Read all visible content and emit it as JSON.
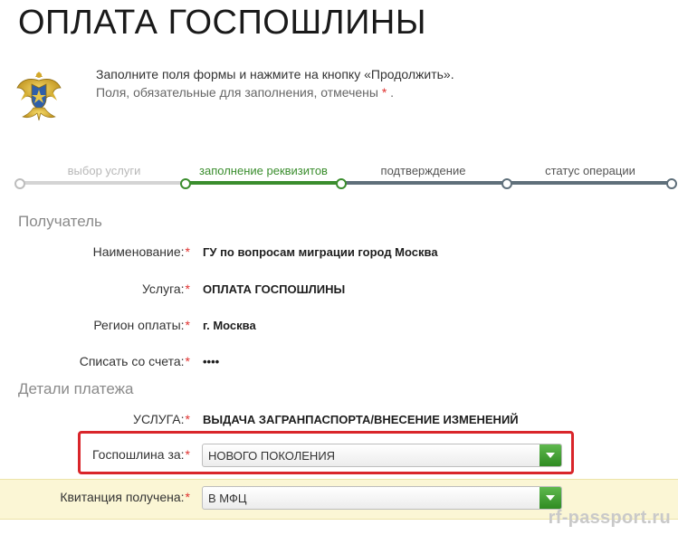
{
  "page": {
    "title": "ОПЛАТА ГОСПОШЛИНЫ",
    "instructions": {
      "line1": "Заполните поля формы и нажмите на кнопку «Продолжить».",
      "line2_text": "Поля, обязательные для заполнения, отмечены",
      "line2_mark": "*",
      "line2_end": "."
    }
  },
  "stepper": {
    "steps": [
      {
        "label": "выбор услуги",
        "state": "done"
      },
      {
        "label": "заполнение реквизитов",
        "state": "active"
      },
      {
        "label": "подтверждение",
        "state": "upcoming"
      },
      {
        "label": "статус операции",
        "state": "upcoming"
      }
    ],
    "colors": {
      "done": "#c8c8c8",
      "active": "#3a8d2d",
      "upcoming": "#5f6f7a"
    }
  },
  "recipient": {
    "title": "Получатель",
    "fields": [
      {
        "label": "Наименование:",
        "required": "*",
        "value": "ГУ по вопросам миграции город Москва"
      },
      {
        "label": "Услуга:",
        "required": "*",
        "value": "ОПЛАТА ГОСПОШЛИНЫ"
      },
      {
        "label": "Регион оплаты:",
        "required": "*",
        "value": "г. Москва"
      },
      {
        "label": "Списать со счета:",
        "required": "*",
        "value": "••••"
      }
    ]
  },
  "payment": {
    "title": "Детали платежа",
    "service": {
      "label": "УСЛУГА:",
      "required": "*",
      "value": "ВЫДАЧА ЗАГРАНПАСПОРТА/ВНЕСЕНИЕ ИЗМЕНЕНИЙ"
    },
    "fee_for": {
      "label": "Госпошлина за:",
      "required": "*",
      "value": "НОВОГО ПОКОЛЕНИЯ"
    },
    "receipt": {
      "label": "Квитанция получена:",
      "required": "*",
      "value": "В МФЦ"
    }
  },
  "watermark": "rf-passport.ru",
  "colors": {
    "accent": "#3a8d2d",
    "required": "#e0302e",
    "highlight": "#fbf6d5",
    "frame": "#d9252a"
  }
}
